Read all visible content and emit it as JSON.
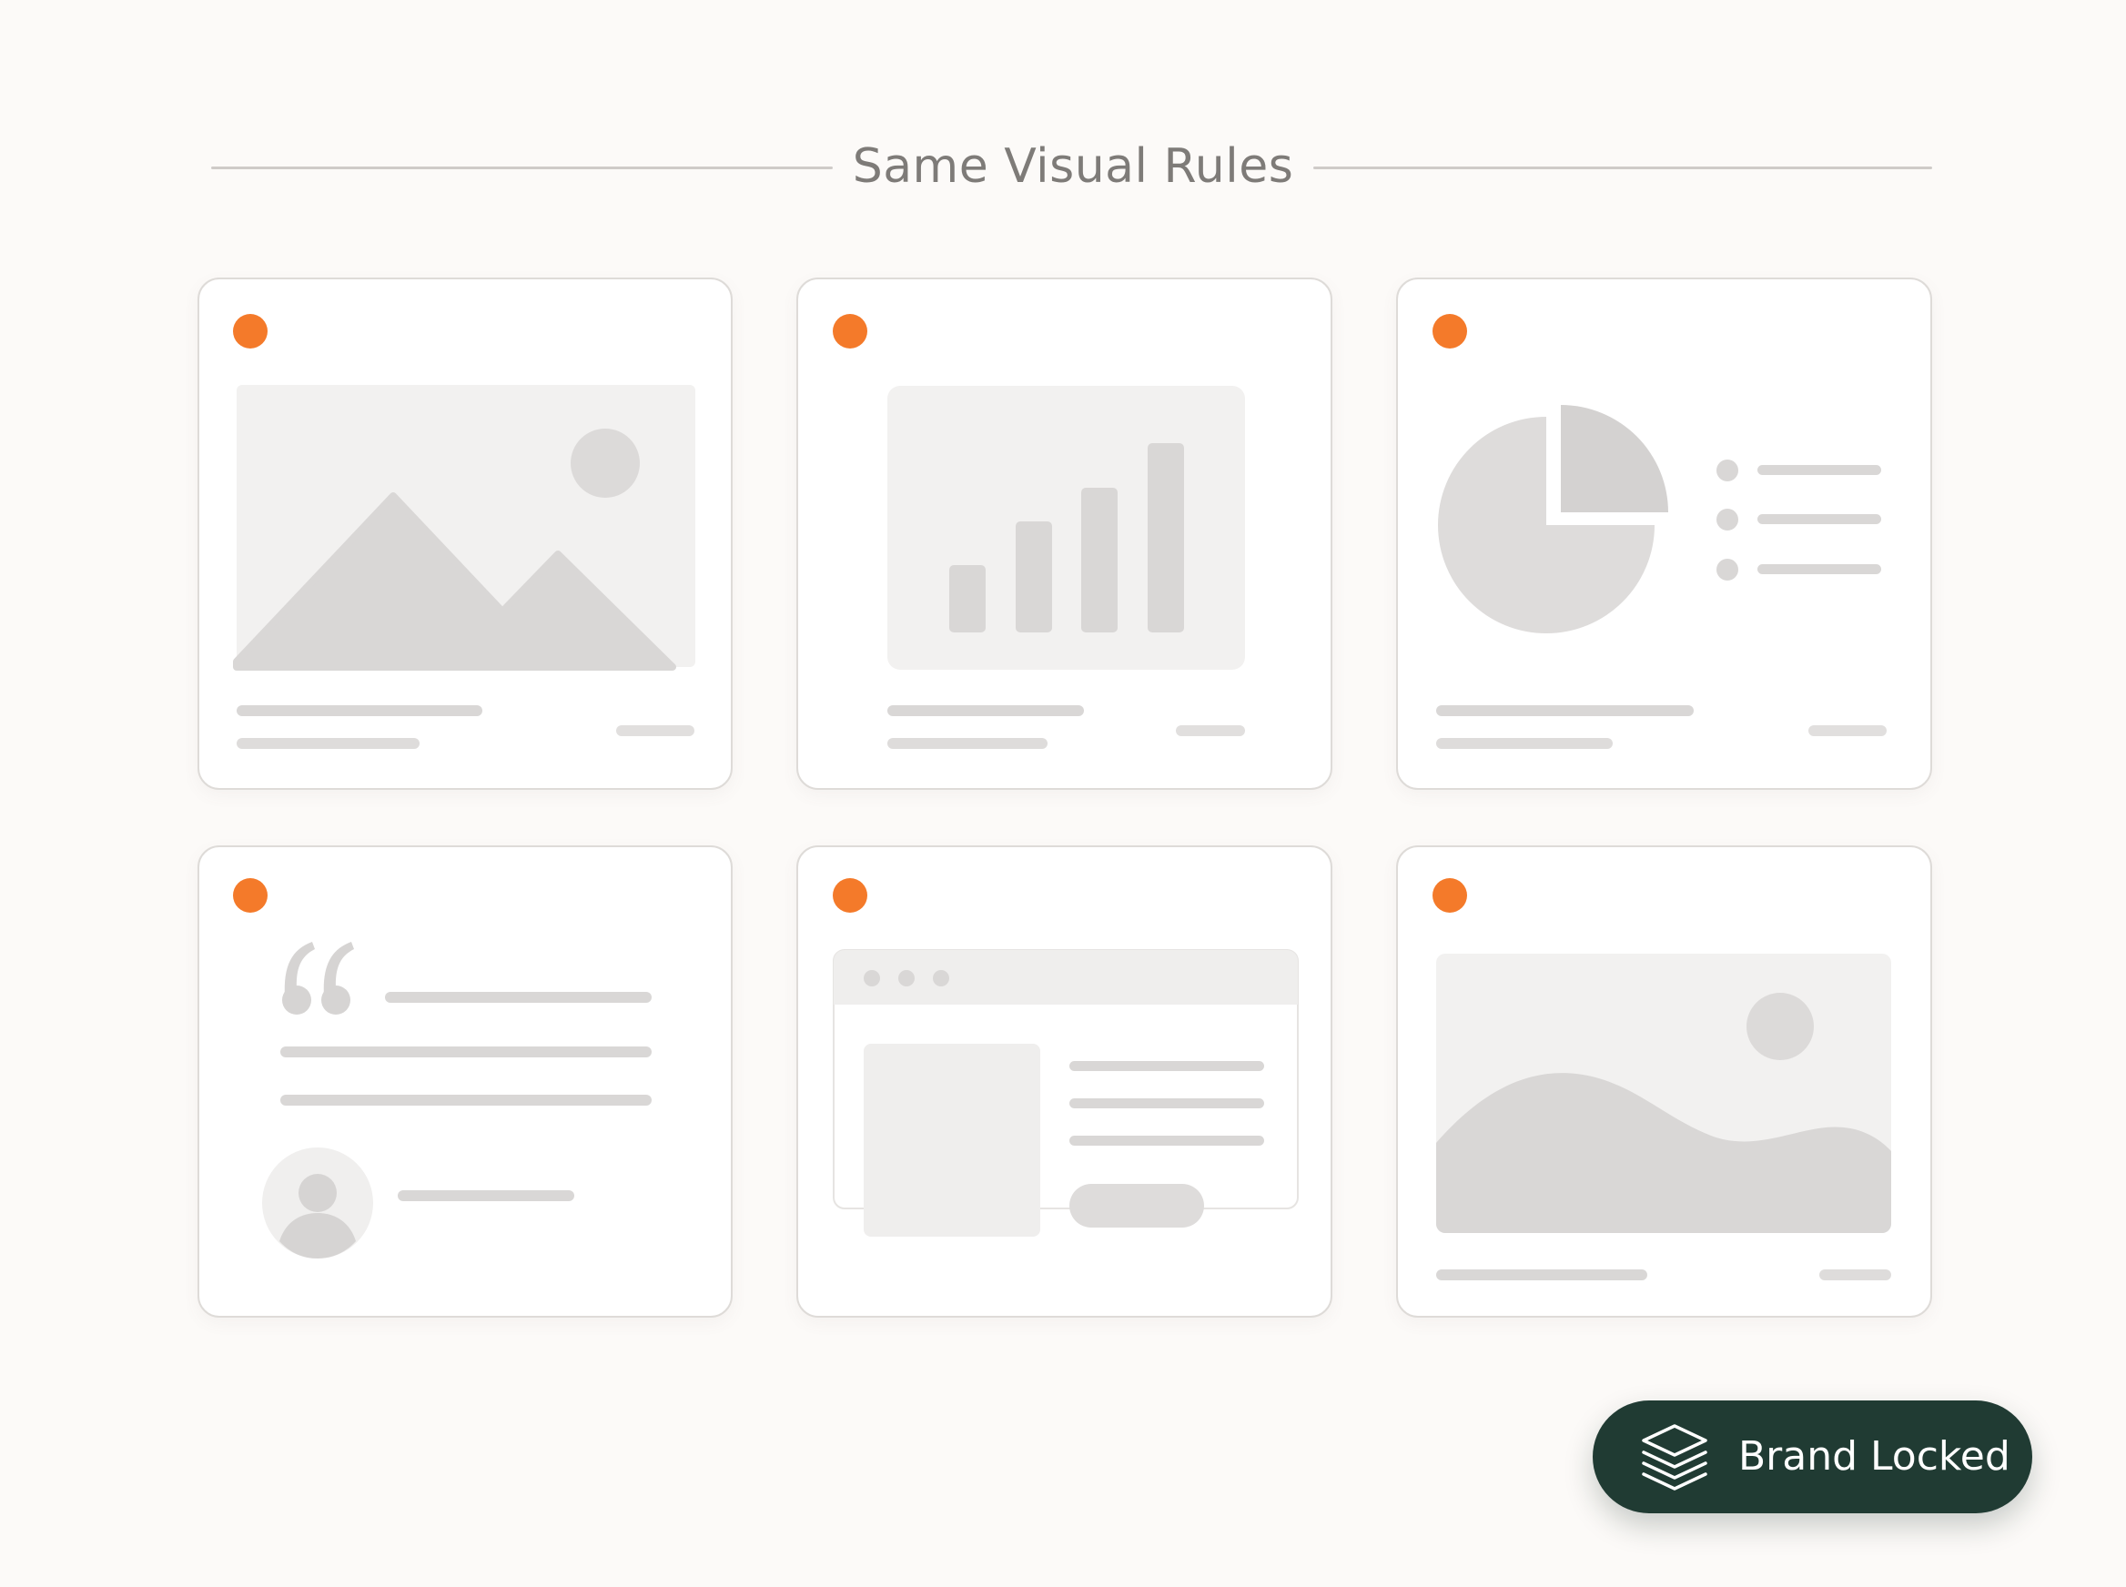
{
  "header": {
    "title": "Same Visual Rules"
  },
  "colors": {
    "accent": "#f47a2a",
    "background": "#fcfaf8",
    "card_border": "#dedbd8",
    "placeholder_light": "#f2f1f0",
    "placeholder_mid": "#d9d7d6",
    "badge_background": "#203b33",
    "badge_text": "#ffffff"
  },
  "cards": [
    {
      "kind": "image-placeholder",
      "icon": "mountains-sun-icon"
    },
    {
      "kind": "bar-chart-placeholder",
      "icon": "bar-chart-icon"
    },
    {
      "kind": "pie-chart-placeholder",
      "icon": "pie-chart-icon"
    },
    {
      "kind": "quote-placeholder",
      "icon": "quote-mark-icon"
    },
    {
      "kind": "web-page-placeholder",
      "icon": "browser-window-icon"
    },
    {
      "kind": "landscape-placeholder",
      "icon": "hills-sun-icon"
    }
  ],
  "badge": {
    "label": "Brand Locked",
    "icon": "layers-stack-icon"
  }
}
